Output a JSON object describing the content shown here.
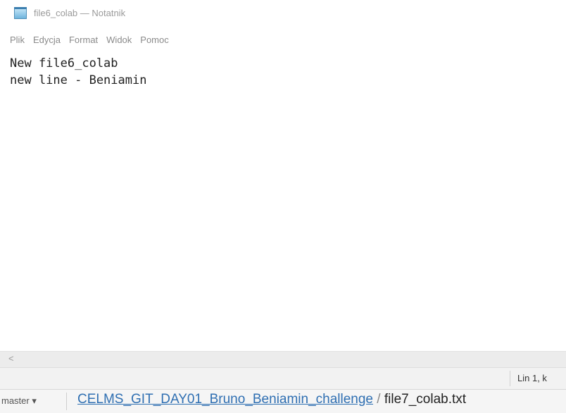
{
  "window": {
    "title": "file6_colab — Notatnik",
    "icon": "notepad-icon"
  },
  "menu": {
    "items": [
      "Plik",
      "Edycja",
      "Format",
      "Widok",
      "Pomoc"
    ]
  },
  "editor": {
    "lines": [
      "New file6_colab",
      "new line - Beniamin"
    ]
  },
  "scrollbar": {
    "left_arrow": "<"
  },
  "status": {
    "position": "Lin 1, k"
  },
  "taskstrip": {
    "branch": "master ▾",
    "repo": "CELMS_GIT_DAY01_Bruno_Beniamin_challenge",
    "separator": " / ",
    "file": "file7_colab.txt"
  }
}
